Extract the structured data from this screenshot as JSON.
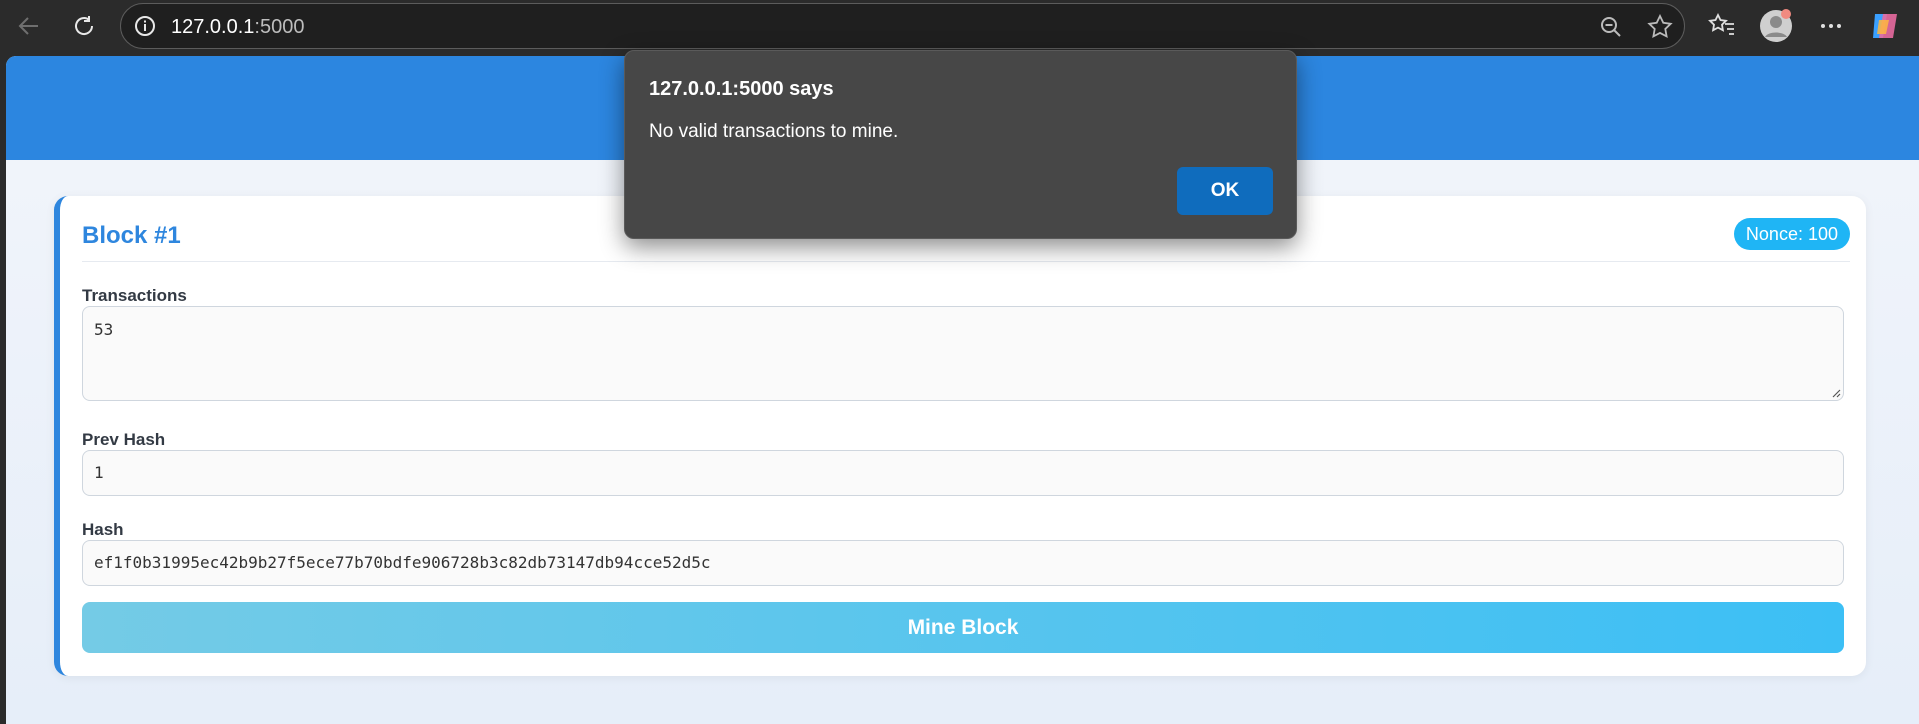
{
  "browser": {
    "url_host": "127.0.0.1",
    "url_port": ":5000",
    "icons": [
      "back-arrow-icon",
      "refresh-icon",
      "info-icon",
      "zoom-out-icon",
      "favorite-star-icon",
      "favorites-icon",
      "profile-avatar-icon",
      "more-menu-icon",
      "copilot-icon"
    ]
  },
  "block": {
    "title": "Block #1",
    "nonce_badge": "Nonce: 100",
    "transactions_label": "Transactions",
    "transactions_value": "53",
    "prev_hash_label": "Prev Hash",
    "prev_hash_value": "1",
    "hash_label": "Hash",
    "hash_value": "ef1f0b31995ec42b9b27f5ece77b70bdfe906728b3c82db73147db94cce52d5c",
    "mine_button_label": "Mine Block"
  },
  "dialog": {
    "title": "127.0.0.1:5000 says",
    "message": "No valid transactions to mine.",
    "ok_label": "OK"
  },
  "colors": {
    "accent": "#2e86de",
    "header": "#2c86e0",
    "badge": "#1fb5f5",
    "dialog_ok": "#0f6cbd"
  }
}
